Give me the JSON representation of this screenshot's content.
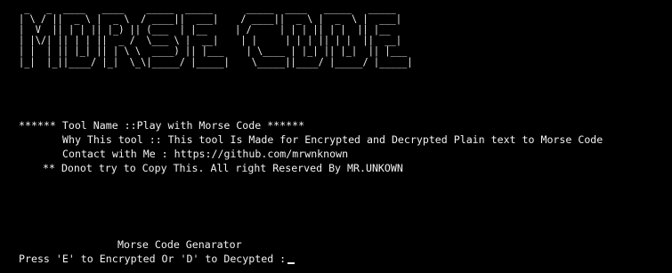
{
  "banner": {
    "art": " _   _  ____   ____    _____  _____      _____  ____   _____   _____\n| \\ / ||  _ \\ |  _ \\  / ____||  ___|    / ____||  _ \\ |  _  \\ |  ___|\n|  V  || | | || |_) || (___  | |__     | /     | | | || | |  || |__\n| |\\/| || | | ||  _ /  \\___ \\ |  __|    | |     | | | || | |  ||  __|\n| |  | || |_| || | \\ \\  ____) || |___    | \\____ | |_| || |_|  || |___\n|_|  |_||____/ |_|  \\_\\|_____/ |_____|    \\_____||____/ |_____/ |_____|"
  },
  "info": {
    "tool_name": "****** Tool Name ::Play with Morse Code ******",
    "why_tool": "Why This tool :: This tool Is Made for Encrypted and Decrypted Plain text to Morse Code",
    "contact": "Contact with Me : https://github.com/mrwnknown",
    "notice": "** Donot try to Copy This. All right Reserved By MR.UNKOWN"
  },
  "generator": {
    "title": "Morse Code Genarator",
    "prompt": "Press 'E' to Encrypted Or 'D' to Decypted :"
  }
}
